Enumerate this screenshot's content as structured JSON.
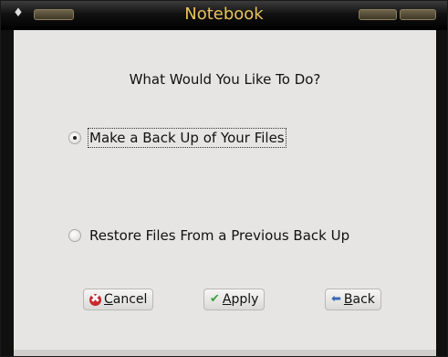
{
  "window": {
    "title": "Notebook",
    "menu_glyph": "♦"
  },
  "dialog": {
    "heading": "What Would You Like To Do?",
    "options": [
      {
        "label": "Make a Back Up of Your Files",
        "selected": true
      },
      {
        "label": "Restore Files From a Previous Back Up",
        "selected": false
      }
    ]
  },
  "buttons": {
    "cancel": {
      "mnemonic": "C",
      "rest": "ancel",
      "icon": "cancel-icon"
    },
    "apply": {
      "mnemonic": "A",
      "rest": "pply",
      "icon": "checkmark-icon"
    },
    "back": {
      "mnemonic": "B",
      "rest": "ack",
      "icon": "back-arrow-icon"
    }
  },
  "colors": {
    "title_text": "#e8c25a",
    "background": "#e6e5e3",
    "cancel_icon": "#c8282d",
    "apply_icon": "#3aa33a",
    "back_icon": "#3a67b8"
  }
}
